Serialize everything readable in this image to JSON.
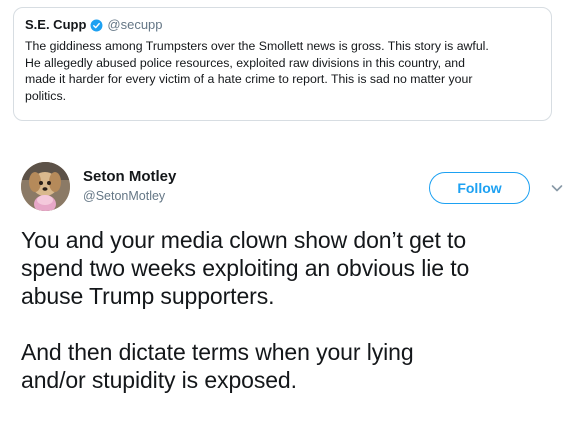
{
  "quoted_tweet": {
    "name": "S.E. Cupp",
    "verified": true,
    "handle": "@secupp",
    "text_lines": [
      "The giddiness among Trumpsters over the Smollett news is gross. This story is awful.",
      "He allegedly abused police resources, exploited raw divisions in this country, and",
      "made it harder for every victim of a hate crime to report. This is sad no matter your",
      "politics."
    ]
  },
  "tweet": {
    "author": {
      "name": "Seton Motley",
      "handle": "@SetonMotley"
    },
    "follow_label": "Follow",
    "paragraph1_lines": [
      "You and your media clown show don’t get to",
      "spend two weeks exploiting an obvious lie to",
      "abuse Trump supporters."
    ],
    "paragraph2_lines": [
      "And then dictate terms when your lying",
      "and/or stupidity is exposed."
    ]
  },
  "icons": {
    "verified": "verified-badge-icon",
    "menu": "chevron-down-icon"
  },
  "colors": {
    "accent": "#1da1f2",
    "secondary_text": "#657786",
    "primary_text": "#14171a",
    "card_border": "#d7dde2"
  }
}
